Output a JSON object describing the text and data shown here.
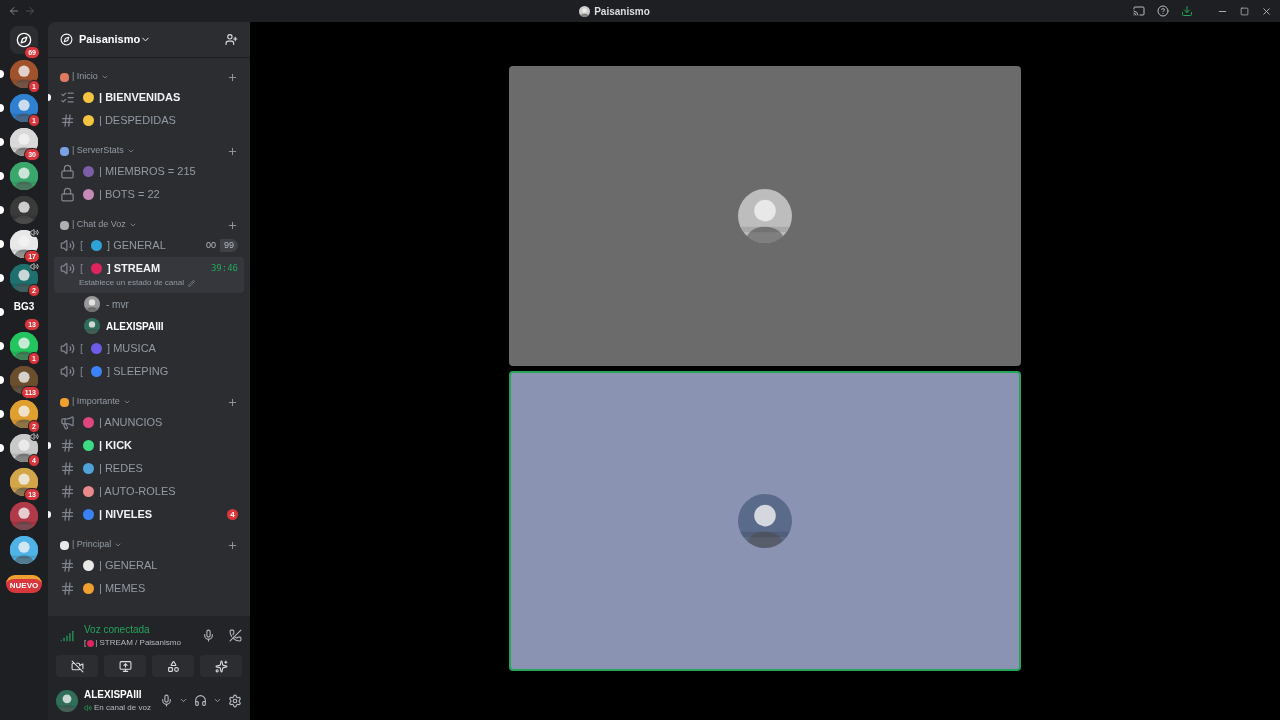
{
  "window": {
    "title": "Paisanismo"
  },
  "servers": [
    {
      "kind": "home",
      "badge": "69",
      "unread": false,
      "color": "#2b2d31",
      "speaking": false
    },
    {
      "kind": "avatar",
      "badge": "1",
      "unread": true,
      "color": "#a0522d",
      "speaking": false
    },
    {
      "kind": "avatar",
      "badge": "1",
      "unread": true,
      "color": "#2f80d1",
      "speaking": false
    },
    {
      "kind": "avatar",
      "badge": "30",
      "unread": true,
      "color": "#d9d9d9",
      "speaking": false
    },
    {
      "kind": "avatar",
      "unread": true,
      "color": "#3aa76d",
      "speaking": false
    },
    {
      "kind": "avatar",
      "unread": true,
      "color": "#3a3a3a",
      "speaking": false
    },
    {
      "kind": "avatar",
      "badge": "17",
      "unread": true,
      "color": "#e8e8e8",
      "speaking": true
    },
    {
      "kind": "avatar",
      "badge": "2",
      "unread": true,
      "color": "#1f6f6f",
      "speaking": true
    },
    {
      "kind": "text",
      "label": "BG3",
      "badge": "13",
      "unread": true,
      "color": "#1e1f22",
      "speaking": false
    },
    {
      "kind": "avatar",
      "badge": "1",
      "unread": true,
      "color": "#22c55e",
      "speaking": false
    },
    {
      "kind": "avatar",
      "badge": "113",
      "unread": true,
      "color": "#6b4e2e",
      "speaking": false
    },
    {
      "kind": "avatar",
      "badge": "2",
      "unread": true,
      "color": "#e0a030",
      "speaking": false
    },
    {
      "kind": "avatar",
      "badge": "4",
      "unread": true,
      "color": "#c9c9c9",
      "speaking": true
    },
    {
      "kind": "avatar",
      "badge": "13",
      "unread": false,
      "color": "#d4a64a",
      "speaking": false
    },
    {
      "kind": "avatar",
      "unread": false,
      "color": "#b03a48",
      "speaking": false
    },
    {
      "kind": "avatar",
      "unread": false,
      "color": "#4fb3e8",
      "speaking": false
    },
    {
      "kind": "new",
      "label": "NUEVO",
      "unread": false,
      "color": "#f0a030",
      "speaking": false
    }
  ],
  "server_header": {
    "name": "Paisanismo"
  },
  "categories": [
    {
      "name": "| Inicio",
      "color": "#e07a5f",
      "channels": [
        {
          "kind": "rules",
          "name": "| BIENVENIDAS",
          "color": "#f5c542",
          "unread": true,
          "selected": false
        },
        {
          "kind": "text",
          "name": "| DESPEDIDAS",
          "color": "#f5c542",
          "unread": false,
          "selected": false
        }
      ]
    },
    {
      "name": "| ServerStats",
      "color": "#7aa2e3",
      "channels": [
        {
          "kind": "locked-voice",
          "name": "| MIEMBROS = 215",
          "color": "#7b5ea7",
          "unread": false,
          "selected": false
        },
        {
          "kind": "locked-voice",
          "name": "| BOTS = 22",
          "color": "#c58ab8",
          "unread": false,
          "selected": false
        }
      ]
    },
    {
      "name": "| Chat de Voz",
      "color": "#b0b0b0",
      "channels": [
        {
          "kind": "voice",
          "prefix": "[",
          "name": "] GENERAL",
          "color": "#2fa3d8",
          "unread": false,
          "selected": false,
          "counter": [
            "00",
            "99"
          ]
        },
        {
          "kind": "voice",
          "prefix": "[",
          "name": "] STREAM",
          "color": "#e0245e",
          "unread": true,
          "selected": true,
          "time": "39:46",
          "status": "Establece un estado de canal",
          "members": [
            {
              "name": "- mvr",
              "bold": false
            },
            {
              "name": "ALEXISPAIII",
              "bold": true
            }
          ]
        },
        {
          "kind": "voice",
          "prefix": "[",
          "name": "] MUSICA",
          "color": "#6c5ce7",
          "unread": false,
          "selected": false
        },
        {
          "kind": "voice",
          "prefix": "[",
          "name": "] SLEEPING",
          "color": "#3b82f6",
          "unread": false,
          "selected": false
        }
      ]
    },
    {
      "name": "| Importante",
      "color": "#f0a030",
      "channels": [
        {
          "kind": "announce",
          "name": "| ANUNCIOS",
          "color": "#e0457b",
          "unread": false,
          "selected": false
        },
        {
          "kind": "text",
          "name": "| KICK",
          "color": "#3ddc84",
          "unread": true,
          "selected": false
        },
        {
          "kind": "text",
          "name": "| REDES",
          "color": "#4fa3d8",
          "unread": false,
          "selected": false
        },
        {
          "kind": "text",
          "name": "| AUTO-ROLES",
          "color": "#e88a8a",
          "unread": false,
          "selected": false
        },
        {
          "kind": "text",
          "name": "| NIVELES",
          "color": "#3b82f6",
          "unread": true,
          "selected": false,
          "badge": "4"
        }
      ]
    },
    {
      "name": "| Principal",
      "color": "#e8e8e8",
      "channels": [
        {
          "kind": "text",
          "name": "| GENERAL",
          "color": "#e8e8e8",
          "unread": false,
          "selected": false
        },
        {
          "kind": "text",
          "name": "| MEMES",
          "color": "#f0a030",
          "unread": false,
          "selected": false
        }
      ]
    }
  ],
  "voice_panel": {
    "status": "Voz conectada",
    "prefix": "[",
    "channel": "| STREAM / Paisanismo",
    "color": "#e0245e"
  },
  "user": {
    "name": "ALEXISPAIII",
    "status": "En canal de voz"
  },
  "tiles": [
    {
      "speaking": false,
      "color": "#6b6b6b"
    },
    {
      "speaking": true,
      "color": "#8a94b2"
    }
  ]
}
